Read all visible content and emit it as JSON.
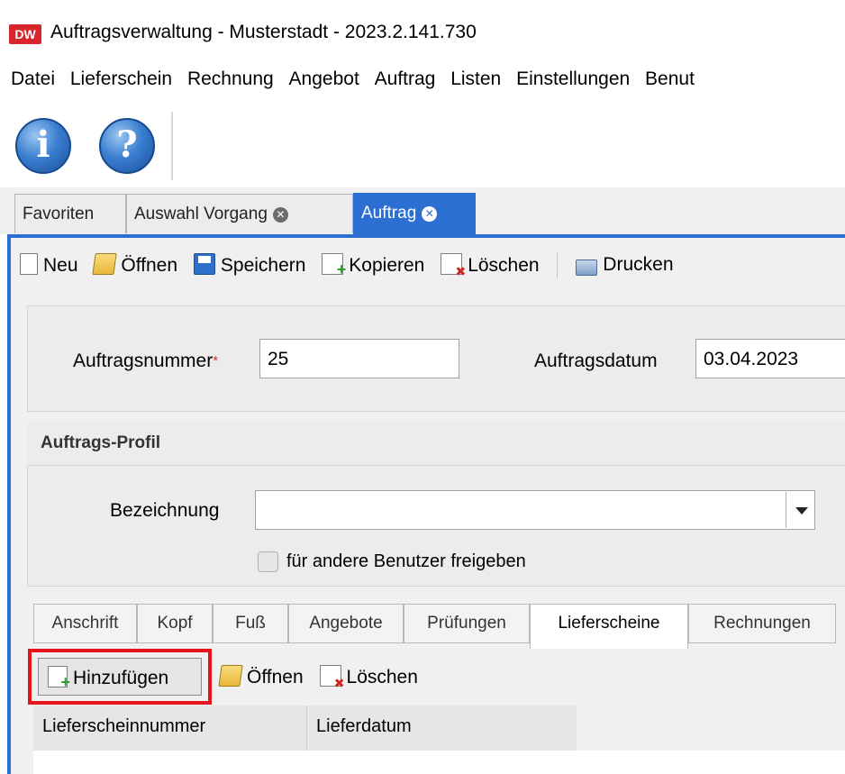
{
  "window": {
    "logo_text": "DW",
    "title": "Auftragsverwaltung - Musterstadt - 2023.2.141.730"
  },
  "menu": {
    "items": [
      "Datei",
      "Lieferschein",
      "Rechnung",
      "Angebot",
      "Auftrag",
      "Listen",
      "Einstellungen",
      "Benut"
    ]
  },
  "toolbar": {
    "info_glyph": "i",
    "help_glyph": "?"
  },
  "doc_tabs": [
    {
      "label": "Favoriten",
      "closable": false,
      "active": false
    },
    {
      "label": "Auswahl Vorgang",
      "closable": true,
      "active": false
    },
    {
      "label": "Auftrag",
      "closable": true,
      "active": true
    }
  ],
  "tab_close_glyph": "✕",
  "actions": {
    "new": "Neu",
    "open": "Öffnen",
    "save": "Speichern",
    "copy": "Kopieren",
    "delete": "Löschen",
    "print": "Drucken"
  },
  "header_form": {
    "order_number_label": "Auftragsnummer",
    "required_mark": "*",
    "order_number_value": "25",
    "order_date_label": "Auftragsdatum",
    "order_date_value": "03.04.2023"
  },
  "profile": {
    "title": "Auftrags-Profil",
    "name_label": "Bezeichnung",
    "name_value": "",
    "share_checkbox_label": "für andere Benutzer freigeben",
    "share_checked": false
  },
  "sub_tabs": [
    "Anschrift",
    "Kopf",
    "Fuß",
    "Angebote",
    "Prüfungen",
    "Lieferscheine",
    "Rechnungen"
  ],
  "sub_tab_active": "Lieferscheine",
  "sub_actions": {
    "add": "Hinzufügen",
    "open": "Öffnen",
    "delete": "Löschen"
  },
  "table": {
    "columns": [
      "Lieferscheinnummer",
      "Lieferdatum"
    ],
    "rows": []
  },
  "colors": {
    "accent": "#2c6fd3",
    "highlight": "#e3141b",
    "required": "#e03030",
    "logo": "#d7262b"
  }
}
